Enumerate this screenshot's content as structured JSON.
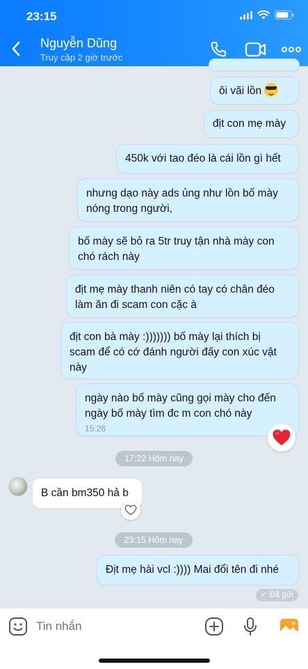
{
  "status_bar": {
    "time": "23:15"
  },
  "header": {
    "contact_name": "Nguyễn Dũng",
    "contact_status": "Truy cập 2 giờ trước",
    "icons": [
      "back-icon",
      "phone-icon",
      "video-call-icon",
      "more-icon"
    ]
  },
  "messages": {
    "m1": {
      "text": "ôi vãi lồn",
      "emoji": "sunglasses-face"
    },
    "m2": {
      "text": "địt con mẹ mày"
    },
    "m3": {
      "text": "450k với tao đéo là cái lồn gì hết"
    },
    "m4": {
      "line1": "nhưng dạo này ads ủng như lồn bố mày",
      "line2": "nóng trong người,"
    },
    "m5": {
      "line1": "bố mày sẽ bỏ ra 5tr truy tận nhà mày con",
      "line2": "chó rách này"
    },
    "m6": {
      "line1": "địt mẹ mày thanh niên có tay có chân đéo",
      "line2": "làm ăn đi scam con cặc à"
    },
    "m7": {
      "line1": "địt con bà mày :))))))) bố mày lại thích bị",
      "line2": "scam để có cớ đánh người đấy con xúc vật",
      "line3": "này"
    },
    "m8": {
      "line1": "ngày nào bố mày cũng gọi mày cho đến",
      "line2": "ngày bố mày tìm đc m con chó này",
      "time": "15:26",
      "reaction": "heart"
    },
    "divider1": "17:22 Hôm nay",
    "r1": {
      "text": "B cần bm350 hả b"
    },
    "divider2": "23:15 Hôm nay",
    "m9": {
      "text": "Địt mẹ hài vcl :)))) Mai đổi tên đi nhé"
    },
    "sent_status": "Đã gửi"
  },
  "input_bar": {
    "placeholder": "Tin nhắn",
    "icons": [
      "sticker-icon",
      "add-icon",
      "microphone-icon",
      "image-icon"
    ]
  },
  "colors": {
    "header_blue": "#0a7bff",
    "sent_bubble": "#d5f0ff",
    "received_bubble": "#ffffff",
    "chat_background": "#e2e9f1",
    "heart_red": "#e8232f"
  }
}
